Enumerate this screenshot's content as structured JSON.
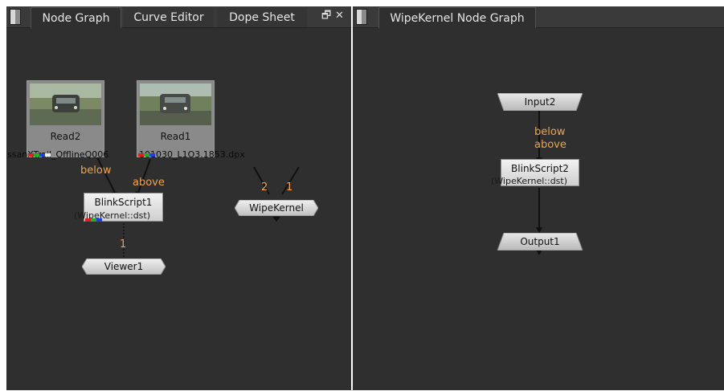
{
  "left_panel": {
    "tabs": [
      {
        "label": "Node Graph"
      },
      {
        "label": "Curve Editor"
      },
      {
        "label": "Dope Sheet"
      }
    ],
    "controls": {
      "float_glyph": "🗗",
      "close_glyph": "✕"
    },
    "nodes": {
      "read2": {
        "label": "Read2",
        "file": "ssanXTrail_OfflineQ006"
      },
      "read1": {
        "label": "Read1",
        "file": "101030_L1O3.1853.dpx"
      },
      "blinkscript1": {
        "label": "BlinkScript1",
        "kernel": "(WipeKernel::dst)"
      },
      "viewer1": {
        "label": "Viewer1"
      },
      "wipekernel": {
        "label": "WipeKernel"
      }
    },
    "edge_labels": {
      "below": "below",
      "above": "above",
      "viewer_input": "1",
      "input_2": "2",
      "input_1": "1"
    }
  },
  "right_panel": {
    "tab": {
      "label": "WipeKernel Node Graph"
    },
    "nodes": {
      "input2": {
        "label": "Input2"
      },
      "blinkscript2": {
        "label": "BlinkScript2",
        "kernel": "(WipeKernel::dst)"
      },
      "output1": {
        "label": "Output1"
      }
    },
    "edge_labels": {
      "below": "below",
      "above": "above"
    }
  },
  "colors": {
    "panel_bg": "#2f2f2f",
    "edge_label": "#f0a34c",
    "swatch": [
      "#e02020",
      "#20b020",
      "#2040e0",
      "#f0f0f0"
    ]
  }
}
